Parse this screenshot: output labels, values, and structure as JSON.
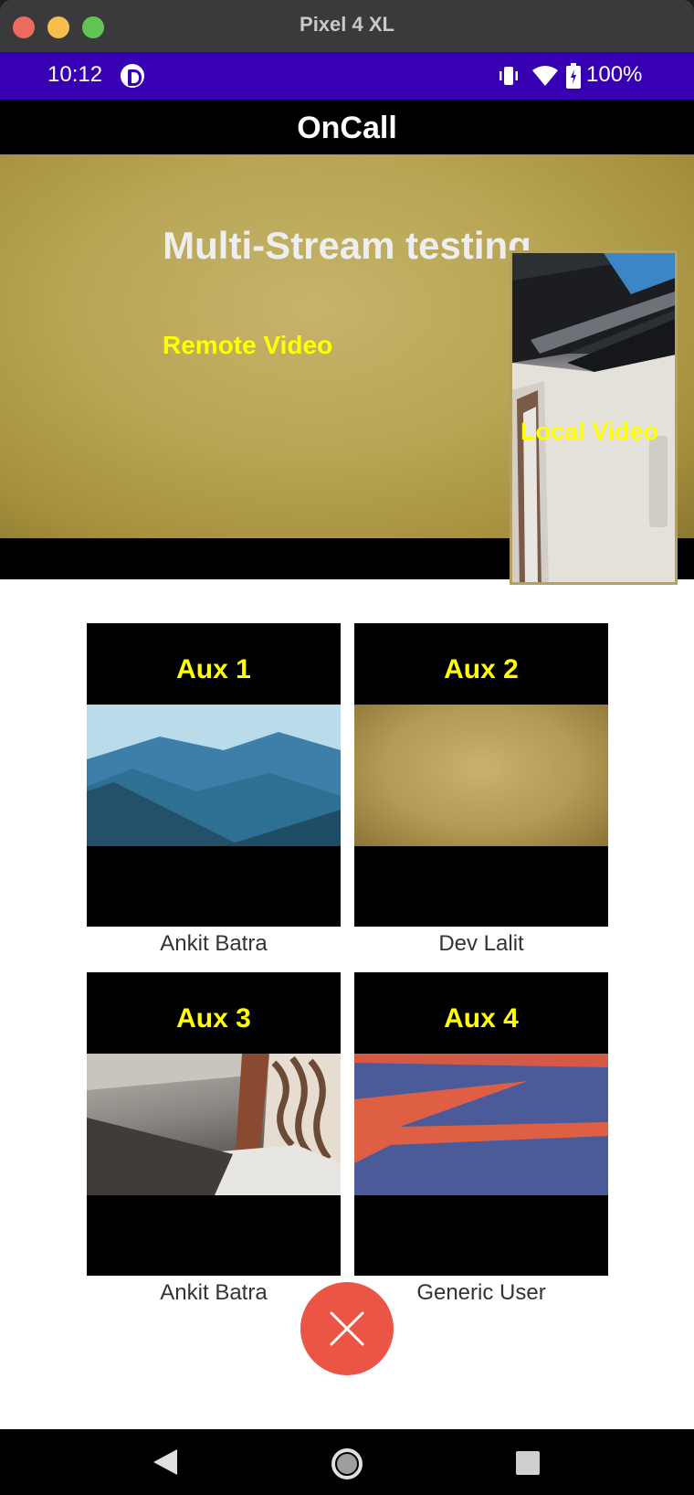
{
  "window": {
    "title": "Pixel 4 XL"
  },
  "status_bar": {
    "time": "10:12",
    "battery": "100%"
  },
  "app": {
    "title": "OnCall"
  },
  "remote": {
    "heading": "Multi-Stream testing",
    "label": "Remote Video"
  },
  "local": {
    "label": "Local Video"
  },
  "aux": [
    {
      "label": "Aux 1",
      "name": "Ankit Batra"
    },
    {
      "label": "Aux 2",
      "name": "Dev Lalit"
    },
    {
      "label": "Aux 3",
      "name": "Ankit Batra"
    },
    {
      "label": "Aux 4",
      "name": "Generic User"
    }
  ],
  "colors": {
    "status_bar": "#3700b3",
    "overlay_text": "#ffff00",
    "end_call": "#ea5545"
  },
  "icons": {
    "end_call": "close-icon",
    "nav_back": "back-triangle-icon",
    "nav_home": "home-circle-icon",
    "nav_recent": "recents-square-icon"
  }
}
